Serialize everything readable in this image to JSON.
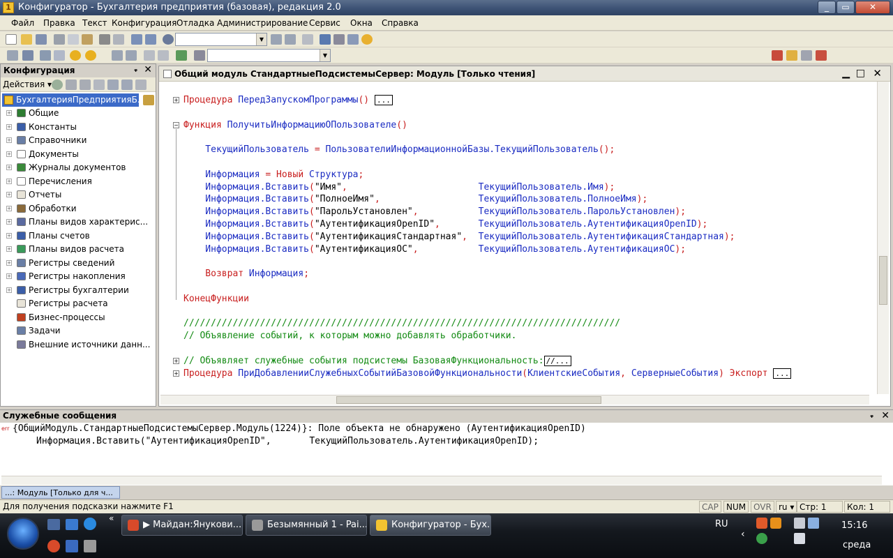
{
  "window": {
    "title": "Конфигуратор - Бухгалтерия предприятия (базовая), редакция 2.0",
    "controls": [
      "_",
      "▭",
      "✕"
    ]
  },
  "menu": [
    "Файл",
    "Правка",
    "Текст",
    "Конфигурация",
    "Отладка",
    "Администрирование",
    "Сервис",
    "Окна",
    "Справка"
  ],
  "left_panel": {
    "title": "Конфигурация",
    "pin": "ᵩ",
    "close": "✕",
    "actions_label": "Действия ▾",
    "root": "БухгалтерияПредприятияБ...",
    "items": [
      {
        "label": "Общие",
        "icon_color": "#2e7d32",
        "expandable": true
      },
      {
        "label": "Константы",
        "icon_color": "#3b5ea8",
        "expandable": true
      },
      {
        "label": "Справочники",
        "icon_color": "#6a7fa6",
        "expandable": true
      },
      {
        "label": "Документы",
        "icon_color": "#ffffff",
        "expandable": true
      },
      {
        "label": "Журналы документов",
        "icon_color": "#3a8a3a",
        "expandable": true
      },
      {
        "label": "Перечисления",
        "icon_color": "#ffffff",
        "expandable": true
      },
      {
        "label": "Отчеты",
        "icon_color": "#e8e4d8",
        "expandable": true
      },
      {
        "label": "Обработки",
        "icon_color": "#8a6a3a",
        "expandable": true
      },
      {
        "label": "Планы видов характерис...",
        "icon_color": "#5a6aa0",
        "expandable": true
      },
      {
        "label": "Планы счетов",
        "icon_color": "#3b5ea8",
        "expandable": true
      },
      {
        "label": "Планы видов расчета",
        "icon_color": "#3a9a5a",
        "expandable": true
      },
      {
        "label": "Регистры сведений",
        "icon_color": "#6a7fa6",
        "expandable": true
      },
      {
        "label": "Регистры накопления",
        "icon_color": "#4a6ab8",
        "expandable": true
      },
      {
        "label": "Регистры бухгалтерии",
        "icon_color": "#3b5ea8",
        "expandable": true
      },
      {
        "label": "Регистры расчета",
        "icon_color": "#e8e4d8",
        "expandable": false
      },
      {
        "label": "Бизнес-процессы",
        "icon_color": "#c04020",
        "expandable": false
      },
      {
        "label": "Задачи",
        "icon_color": "#6a7fa6",
        "expandable": false
      },
      {
        "label": "Внешние источники данн...",
        "icon_color": "#7a7a9a",
        "expandable": false
      }
    ]
  },
  "editor": {
    "title": "Общий модуль СтандартныеПодсистемыСервер: Модуль [Только чтения]",
    "lines": [
      {
        "fold": "+",
        "parts": [
          {
            "c": "kw",
            "t": "Процедура "
          },
          {
            "c": "id",
            "t": "ПередЗапускомПрограммы"
          },
          {
            "c": "kw",
            "t": "()"
          },
          {
            "c": "blk",
            "t": " "
          },
          {
            "c": "ell",
            "t": "..."
          }
        ]
      },
      {
        "parts": []
      },
      {
        "fold": "−",
        "parts": [
          {
            "c": "kw",
            "t": "Функция "
          },
          {
            "c": "id",
            "t": "ПолучитьИнформациюОПользователе"
          },
          {
            "c": "kw",
            "t": "()"
          }
        ]
      },
      {
        "parts": []
      },
      {
        "parts": [
          {
            "c": "id",
            "t": "    ТекущийПользователь "
          },
          {
            "c": "kw",
            "t": "= "
          },
          {
            "c": "id",
            "t": "ПользователиИнформационнойБазы.ТекущийПользователь"
          },
          {
            "c": "kw",
            "t": "();"
          }
        ]
      },
      {
        "parts": []
      },
      {
        "parts": [
          {
            "c": "id",
            "t": "    Информация "
          },
          {
            "c": "kw",
            "t": "= Новый "
          },
          {
            "c": "id",
            "t": "Структура"
          },
          {
            "c": "kw",
            "t": ";"
          }
        ]
      },
      {
        "parts": [
          {
            "c": "id",
            "t": "    Информация.Вставить"
          },
          {
            "c": "kw",
            "t": "("
          },
          {
            "c": "str",
            "t": "\"Имя\""
          },
          {
            "c": "kw",
            "t": ","
          },
          {
            "c": "id",
            "t": "                        ТекущийПользователь.Имя"
          },
          {
            "c": "kw",
            "t": ");"
          }
        ]
      },
      {
        "parts": [
          {
            "c": "id",
            "t": "    Информация.Вставить"
          },
          {
            "c": "kw",
            "t": "("
          },
          {
            "c": "str",
            "t": "\"ПолноеИмя\""
          },
          {
            "c": "kw",
            "t": ","
          },
          {
            "c": "id",
            "t": "                  ТекущийПользователь.ПолноеИмя"
          },
          {
            "c": "kw",
            "t": ");"
          }
        ]
      },
      {
        "parts": [
          {
            "c": "id",
            "t": "    Информация.Вставить"
          },
          {
            "c": "kw",
            "t": "("
          },
          {
            "c": "str",
            "t": "\"ПарольУстановлен\""
          },
          {
            "c": "kw",
            "t": ","
          },
          {
            "c": "id",
            "t": "           ТекущийПользователь.ПарольУстановлен"
          },
          {
            "c": "kw",
            "t": ");"
          }
        ]
      },
      {
        "parts": [
          {
            "c": "id",
            "t": "    Информация.Вставить"
          },
          {
            "c": "kw",
            "t": "("
          },
          {
            "c": "str",
            "t": "\"АутентификацияOpenID\""
          },
          {
            "c": "kw",
            "t": ","
          },
          {
            "c": "id",
            "t": "       ТекущийПользователь.АутентификацияOpenID"
          },
          {
            "c": "kw",
            "t": ");"
          }
        ]
      },
      {
        "parts": [
          {
            "c": "id",
            "t": "    Информация.Вставить"
          },
          {
            "c": "kw",
            "t": "("
          },
          {
            "c": "str",
            "t": "\"АутентификацияСтандартная\""
          },
          {
            "c": "kw",
            "t": ","
          },
          {
            "c": "id",
            "t": "  ТекущийПользователь.АутентификацияСтандартная"
          },
          {
            "c": "kw",
            "t": ");"
          }
        ]
      },
      {
        "parts": [
          {
            "c": "id",
            "t": "    Информация.Вставить"
          },
          {
            "c": "kw",
            "t": "("
          },
          {
            "c": "str",
            "t": "\"АутентификацияОС\""
          },
          {
            "c": "kw",
            "t": ","
          },
          {
            "c": "id",
            "t": "           ТекущийПользователь.АутентификацияОС"
          },
          {
            "c": "kw",
            "t": ");"
          }
        ]
      },
      {
        "parts": []
      },
      {
        "parts": [
          {
            "c": "kw",
            "t": "    Возврат "
          },
          {
            "c": "id",
            "t": "Информация"
          },
          {
            "c": "kw",
            "t": ";"
          }
        ]
      },
      {
        "parts": []
      },
      {
        "parts": [
          {
            "c": "kw",
            "t": "КонецФункции"
          }
        ]
      },
      {
        "parts": []
      },
      {
        "parts": [
          {
            "c": "cm",
            "t": "////////////////////////////////////////////////////////////////////////////////"
          }
        ]
      },
      {
        "parts": [
          {
            "c": "cm",
            "t": "// Объявление событий, к которым можно добавлять обработчики."
          }
        ]
      },
      {
        "parts": []
      },
      {
        "fold": "+",
        "parts": [
          {
            "c": "cm",
            "t": "// Объявляет служебные события подсистемы БазоваяФункциональность:"
          },
          {
            "c": "ell",
            "t": "//..."
          }
        ]
      },
      {
        "fold": "+",
        "parts": [
          {
            "c": "kw",
            "t": "Процедура "
          },
          {
            "c": "id",
            "t": "ПриДобавленииСлужебныхСобытийБазовойФункциональности"
          },
          {
            "c": "kw",
            "t": "("
          },
          {
            "c": "id",
            "t": "КлиентскиеСобытия"
          },
          {
            "c": "kw",
            "t": ", "
          },
          {
            "c": "id",
            "t": "СерверныеСобытия"
          },
          {
            "c": "kw",
            "t": ") Экспорт "
          },
          {
            "c": "ell",
            "t": "..."
          }
        ]
      }
    ]
  },
  "messages": {
    "title": "Служебные сообщения",
    "prefix": "err",
    "line1": "{ОбщийМодуль.СтандартныеПодсистемыСервер.Модуль(1224)}: Поле объекта не обнаружено (АутентификацияOpenID)",
    "line2": "Информация.Вставить(\"АутентификацияOpenID\",       ТекущийПользователь.АутентификацияOpenID);"
  },
  "window_tab": "...: Модуль [Только для ч...",
  "status": {
    "hint": "Для получения подсказки нажмите F1",
    "cap": "CAP",
    "num": "NUM",
    "ovr": "OVR",
    "lang": "ru ▾",
    "line": "Стр: 1",
    "col": "Кол: 1"
  },
  "taskbar": {
    "items": [
      {
        "label": "▶ Майдан:Янукови...",
        "icon_color": "#d84a2a"
      },
      {
        "label": "Безымянный 1 - Pai...",
        "icon_color": "#9a9a9a"
      },
      {
        "label": "Конфигуратор - Бух...",
        "icon_color": "#f2c331"
      }
    ],
    "lang": "RU",
    "time": "15:16",
    "day": "среда",
    "chevron": "«"
  }
}
